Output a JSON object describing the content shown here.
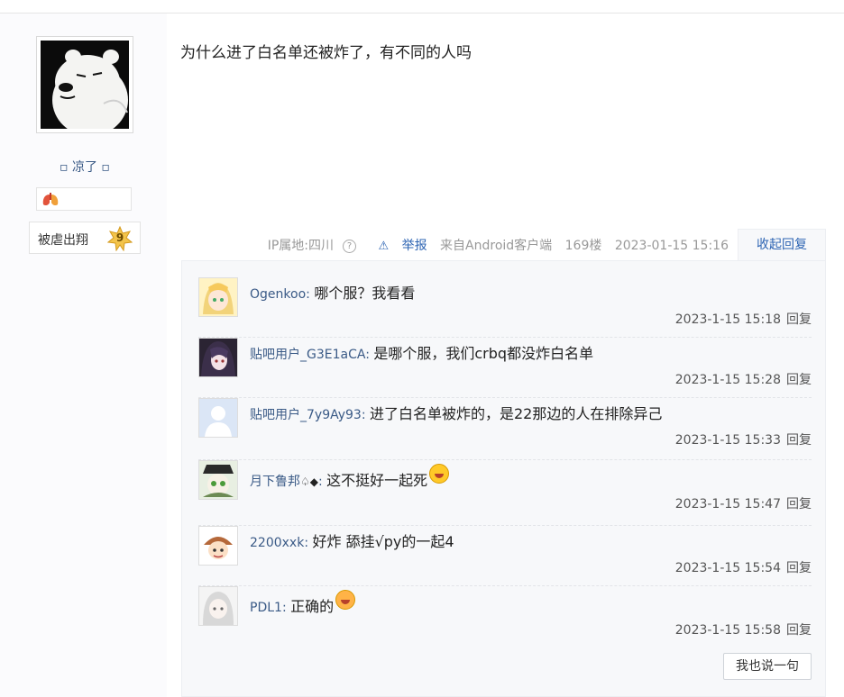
{
  "author": {
    "username": "▫ 凉了 ▫",
    "badge_icon": "lungs-icon",
    "level_name": "被虐出翔",
    "level_number": "9"
  },
  "post": {
    "content": "为什么进了白名单还被炸了，有不同的人吗"
  },
  "meta": {
    "ip_location": "IP属地:四川",
    "report": "举报",
    "source": "来自Android客户端",
    "floor": "169楼",
    "datetime": "2023-01-15 15:16",
    "collapse": "收起回复"
  },
  "replies": [
    {
      "user": "Ogenkoo",
      "text": "哪个服？我看看",
      "time": "2023-1-15 15:18",
      "reply_label": "回复"
    },
    {
      "user": "贴吧用户_G3E1aCA",
      "text": "是哪个服，我们crbq都没炸白名单",
      "time": "2023-1-15 15:28",
      "reply_label": "回复"
    },
    {
      "user": "贴吧用户_7y9Ay93",
      "text": "进了白名单被炸的，是22那边的人在排除异己",
      "time": "2023-1-15 15:33",
      "reply_label": "回复"
    },
    {
      "user": "月下鲁邦",
      "user_suffix": "♤◆",
      "text": "这不挺好一起死",
      "time": "2023-1-15 15:47",
      "reply_label": "回复"
    },
    {
      "user": "2200xxk",
      "text": "好炸 舔挂√py的一起4",
      "time": "2023-1-15 15:54",
      "reply_label": "回复"
    },
    {
      "user": "PDL1",
      "text": "正确的",
      "time": "2023-1-15 15:58",
      "reply_label": "回复"
    }
  ],
  "say_button": "我也说一句",
  "colors": {
    "link": "#2d64b3",
    "username": "#3a5a86",
    "panel_bg": "#f7f8fa"
  }
}
